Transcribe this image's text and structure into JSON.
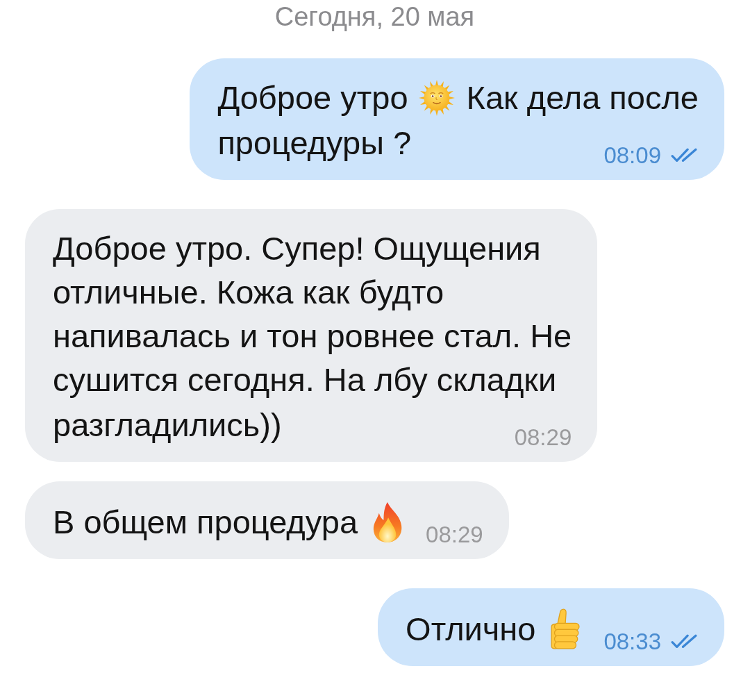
{
  "date_header": "Сегодня, 20 мая",
  "messages": [
    {
      "kind": "outgoing",
      "lines": [
        {
          "parts": [
            {
              "kind": "text",
              "text": "Доброе утро"
            },
            {
              "kind": "sun"
            },
            {
              "kind": "text",
              "text": "Как дела после"
            }
          ]
        },
        {
          "parts": [
            {
              "kind": "text",
              "text": "процедуры ?"
            }
          ]
        }
      ],
      "time": "08:09",
      "read": true
    },
    {
      "kind": "incoming",
      "lines": [
        {
          "parts": [
            {
              "kind": "text",
              "text": "Доброе утро. Супер! Ощущения"
            }
          ]
        },
        {
          "parts": [
            {
              "kind": "text",
              "text": "отличные. Кожа как будто"
            }
          ]
        },
        {
          "parts": [
            {
              "kind": "text",
              "text": "напивалась и тон ровнее стал. Не"
            }
          ]
        },
        {
          "parts": [
            {
              "kind": "text",
              "text": "сушится сегодня. На лбу складки"
            }
          ]
        },
        {
          "parts": [
            {
              "kind": "text",
              "text": "разгладились))"
            }
          ]
        }
      ],
      "time": "08:29"
    },
    {
      "kind": "incoming",
      "lines": [
        {
          "parts": [
            {
              "kind": "text",
              "text": "В общем процедура"
            },
            {
              "kind": "fire"
            }
          ]
        }
      ],
      "time": "08:29"
    },
    {
      "kind": "outgoing",
      "lines": [
        {
          "parts": [
            {
              "kind": "text",
              "text": "Отлично"
            },
            {
              "kind": "thumbsup"
            }
          ]
        }
      ],
      "time": "08:33",
      "read": true
    }
  ]
}
